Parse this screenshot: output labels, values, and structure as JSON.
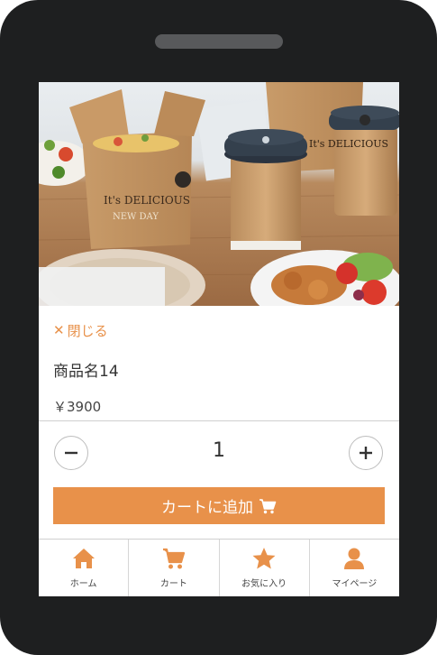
{
  "colors": {
    "accent": "#e8914a",
    "frame": "#1e1f20"
  },
  "detail": {
    "close_label": "閉じる",
    "product_name": "商品名14",
    "price": "￥3900",
    "quantity": "1",
    "add_to_cart_label": "カートに追加"
  },
  "photo": {
    "cup_text": "It's DELICIOUS",
    "box_text": "It's DELICIOUS",
    "box_subtext": "NEW DAY"
  },
  "nav": {
    "items": [
      {
        "label": "ホーム",
        "icon": "home-icon"
      },
      {
        "label": "カート",
        "icon": "cart-icon"
      },
      {
        "label": "お気に入り",
        "icon": "star-icon"
      },
      {
        "label": "マイページ",
        "icon": "user-icon"
      }
    ]
  }
}
